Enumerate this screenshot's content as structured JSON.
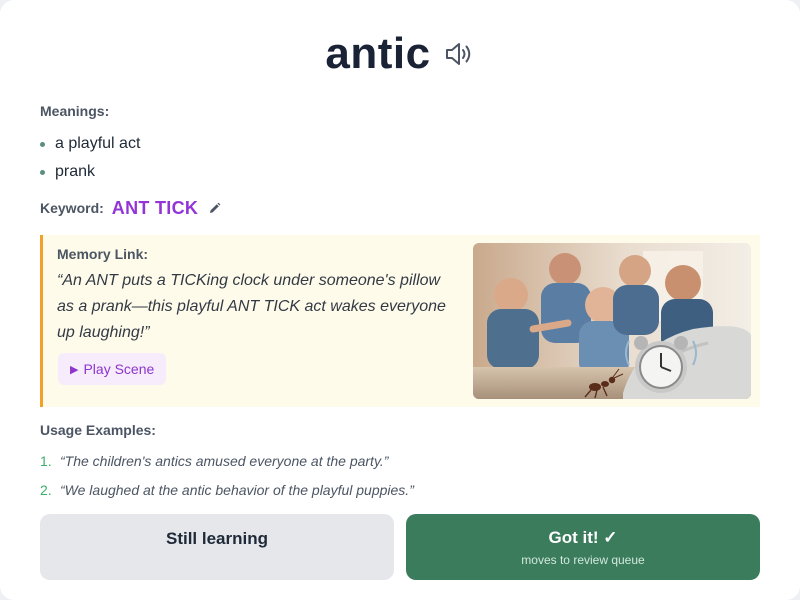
{
  "word": "antic",
  "meanings_label": "Meanings:",
  "meanings": [
    "a playful act",
    "prank"
  ],
  "keyword": {
    "label": "Keyword:",
    "value": "ANT TICK"
  },
  "memory": {
    "label": "Memory Link:",
    "text": "“An ANT puts a TICKing clock under someone's pillow as a prank—this playful ANT TICK act wakes everyone up laughing!”",
    "play_label": "Play Scene",
    "play_icon": "play-triangle-icon"
  },
  "usage_label": "Usage Examples:",
  "usage": [
    {
      "num": "1.",
      "text": "“The children's antics amused everyone at the party.”"
    },
    {
      "num": "2.",
      "text": "“We laughed at the antic behavior of the playful puppies.”"
    }
  ],
  "buttons": {
    "still_learning": "Still learning",
    "got_it": "Got it! ✓",
    "got_it_sub": "moves to review queue"
  },
  "colors": {
    "keyword": "#9334d6",
    "memory_bg": "#fefbea",
    "memory_border": "#f1a02a",
    "got_it_bg": "#3a7c5c",
    "still_learning_bg": "#e5e7eb"
  },
  "icons": {
    "speaker": "speaker-icon",
    "edit": "pencil-icon"
  }
}
